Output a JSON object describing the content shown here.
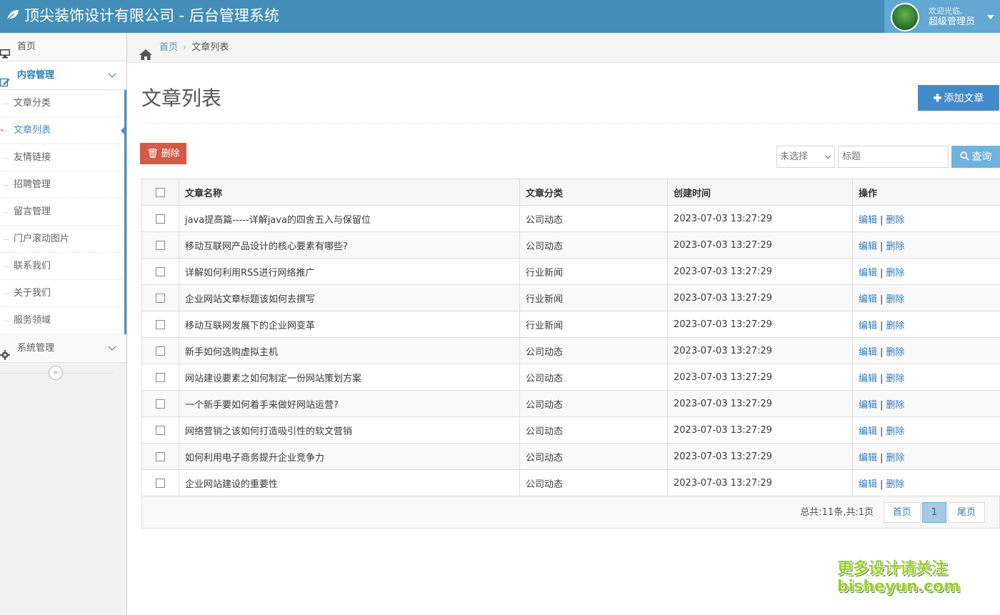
{
  "app": {
    "brand": "顶尖装饰设计有限公司 - 后台管理系统",
    "welcome": "欢迎光临,",
    "user": "超级管理员"
  },
  "sidebar": {
    "home": "首页",
    "content_group": "内容管理",
    "content_items": [
      "文章分类",
      "文章列表",
      "友情链接",
      "招聘管理",
      "留言管理",
      "门户滚动图片",
      "联系我们",
      "关于我们",
      "服务领域"
    ],
    "system_group": "系统管理",
    "collapse": "«"
  },
  "breadcrumb": {
    "home": "首页",
    "current": "文章列表"
  },
  "page": {
    "title": "文章列表",
    "add_button": "添加文章"
  },
  "toolbar": {
    "delete_button": "删除",
    "category_select": "未选择",
    "title_placeholder": "标题",
    "search_button": "查询"
  },
  "table": {
    "headers": [
      "文章名称",
      "文章分类",
      "创建时间",
      "操作"
    ],
    "edit": "编辑",
    "delete": "删除",
    "separator": "|",
    "rows": [
      {
        "name": "java提高篇-----详解java的四舍五入与保留位",
        "category": "公司动态",
        "created": "2023-07-03 13:27:29"
      },
      {
        "name": "移动互联网产品设计的核心要素有哪些?",
        "category": "公司动态",
        "created": "2023-07-03 13:27:29"
      },
      {
        "name": "详解如何利用RSS进行网络推广",
        "category": "行业新闻",
        "created": "2023-07-03 13:27:29"
      },
      {
        "name": "企业网站文章标题该如何去撰写",
        "category": "行业新闻",
        "created": "2023-07-03 13:27:29"
      },
      {
        "name": "移动互联网发展下的企业网变革",
        "category": "行业新闻",
        "created": "2023-07-03 13:27:29"
      },
      {
        "name": "新手如何选购虚拟主机",
        "category": "公司动态",
        "created": "2023-07-03 13:27:29"
      },
      {
        "name": "网站建设要素之如何制定一份网站策划方案",
        "category": "公司动态",
        "created": "2023-07-03 13:27:29"
      },
      {
        "name": "一个新手要如何着手来做好网站运营?",
        "category": "公司动态",
        "created": "2023-07-03 13:27:29"
      },
      {
        "name": "网络营销之该如何打造吸引性的软文营销",
        "category": "公司动态",
        "created": "2023-07-03 13:27:29"
      },
      {
        "name": "如何利用电子商务提升企业竞争力",
        "category": "公司动态",
        "created": "2023-07-03 13:27:29"
      },
      {
        "name": "企业网站建设的重要性",
        "category": "公司动态",
        "created": "2023-07-03 13:27:29"
      }
    ]
  },
  "pagination": {
    "total": "总共:11条,共:1页",
    "first": "首页",
    "current": "1",
    "last": "尾页"
  },
  "watermark": {
    "line1": "更多设计请关注",
    "line2": "bisheyun.com"
  },
  "colors": {
    "navbar": "#438eb9",
    "accent": "#428bca",
    "danger": "#d15b47"
  }
}
